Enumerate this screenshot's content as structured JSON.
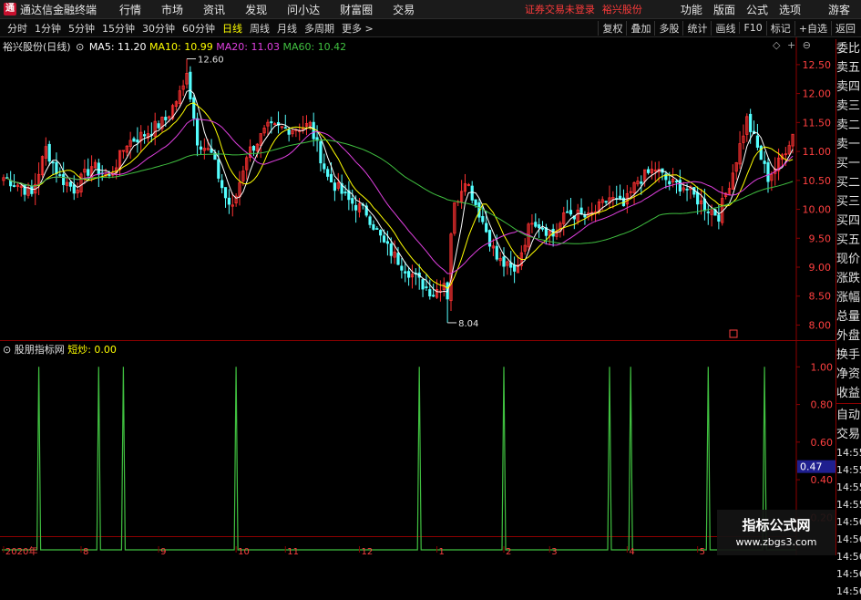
{
  "titlebar": {
    "app_name": "通达信金融终端",
    "menus": [
      "行情",
      "市场",
      "资讯",
      "发现",
      "问小达",
      "财富圈",
      "交易"
    ],
    "status": "证券交易未登录",
    "stock_name": "裕兴股份",
    "right_items": [
      "功能",
      "版面",
      "公式",
      "选项"
    ],
    "user": "游客"
  },
  "toolbar": {
    "periods": [
      "分时",
      "1分钟",
      "5分钟",
      "15分钟",
      "30分钟",
      "60分钟",
      "日线",
      "周线",
      "月线",
      "多周期",
      "更多 >"
    ],
    "active_period": "日线",
    "right_buttons": [
      "复权",
      "叠加",
      "多股",
      "统计",
      "画线",
      "F10",
      "标记",
      "+自选",
      "返回"
    ]
  },
  "main_legend": {
    "title": "裕兴股份(日线)",
    "ma": [
      {
        "label": "MA5: 11.20",
        "color": "#ffffff"
      },
      {
        "label": "MA10: 10.99",
        "color": "#ffff00"
      },
      {
        "label": "MA20: 11.03",
        "color": "#e040e0"
      },
      {
        "label": "MA60: 10.42",
        "color": "#40c040"
      }
    ]
  },
  "indicator_legend": {
    "name": "股朋指标网",
    "value_label": "短炒: 0.00",
    "value_color": "#ffff00"
  },
  "side_panel": {
    "items": [
      "委比",
      "卖五",
      "卖四",
      "卖三",
      "卖二",
      "卖一",
      "买一",
      "买二",
      "买三",
      "买四",
      "买五",
      "现价",
      "涨跌",
      "涨幅",
      "总量",
      "外盘",
      "换手",
      "净资",
      "收益",
      "自动",
      "交易"
    ],
    "times": [
      "14:55",
      "14:55",
      "14:55",
      "14:55",
      "14:56",
      "14:56",
      "14:56",
      "14:56",
      "14:56"
    ]
  },
  "watermark": {
    "line1": "指标公式网",
    "line2": "www.zbgs3.com"
  },
  "chart_data": [
    {
      "type": "candlestick",
      "title": "裕兴股份(日线)",
      "ylim": [
        7.85,
        12.75
      ],
      "yticks": [
        8.0,
        8.5,
        9.0,
        9.5,
        10.0,
        10.5,
        11.0,
        11.5,
        12.0,
        12.5
      ],
      "x_month_labels": [
        {
          "label": "2020年",
          "index": 0
        },
        {
          "label": "8",
          "index": 22
        },
        {
          "label": "9",
          "index": 44
        },
        {
          "label": "10",
          "index": 66
        },
        {
          "label": "11",
          "index": 80
        },
        {
          "label": "12",
          "index": 101
        },
        {
          "label": "1",
          "index": 123
        },
        {
          "label": "2",
          "index": 142
        },
        {
          "label": "3",
          "index": 155
        },
        {
          "label": "4",
          "index": 177
        },
        {
          "label": "5",
          "index": 197
        }
      ],
      "n_bars": 225,
      "annotations": [
        {
          "text": "12.60",
          "value": 12.6,
          "index": 52
        },
        {
          "text": "8.04",
          "value": 8.04,
          "index": 126
        }
      ],
      "close_anchors": [
        [
          0,
          10.55
        ],
        [
          5,
          10.4
        ],
        [
          8,
          10.25
        ],
        [
          12,
          11.05
        ],
        [
          16,
          10.55
        ],
        [
          20,
          10.35
        ],
        [
          25,
          10.75
        ],
        [
          30,
          10.55
        ],
        [
          35,
          11.15
        ],
        [
          40,
          11.3
        ],
        [
          46,
          11.55
        ],
        [
          51,
          12.1
        ],
        [
          52,
          12.35
        ],
        [
          55,
          11.2
        ],
        [
          59,
          10.95
        ],
        [
          63,
          10.2
        ],
        [
          65,
          10.0
        ],
        [
          69,
          10.95
        ],
        [
          75,
          11.4
        ],
        [
          82,
          11.4
        ],
        [
          87,
          11.45
        ],
        [
          92,
          10.55
        ],
        [
          98,
          10.15
        ],
        [
          103,
          9.95
        ],
        [
          108,
          9.4
        ],
        [
          113,
          9.05
        ],
        [
          118,
          8.75
        ],
        [
          122,
          8.55
        ],
        [
          125,
          8.75
        ],
        [
          128,
          10.05
        ],
        [
          131,
          10.55
        ],
        [
          135,
          9.95
        ],
        [
          140,
          9.15
        ],
        [
          145,
          8.9
        ],
        [
          150,
          9.85
        ],
        [
          156,
          9.55
        ],
        [
          160,
          9.95
        ],
        [
          166,
          9.85
        ],
        [
          172,
          10.2
        ],
        [
          176,
          10.05
        ],
        [
          180,
          10.5
        ],
        [
          185,
          10.7
        ],
        [
          189,
          10.45
        ],
        [
          193,
          10.4
        ],
        [
          199,
          10.05
        ],
        [
          203,
          9.9
        ],
        [
          207,
          10.65
        ],
        [
          211,
          11.55
        ],
        [
          214,
          11.05
        ],
        [
          217,
          10.55
        ],
        [
          220,
          10.8
        ],
        [
          224,
          11.3
        ]
      ],
      "ma_last": {
        "MA5": 11.2,
        "MA10": 10.99,
        "MA20": 11.03,
        "MA60": 10.42
      },
      "up_color": "#ff3232",
      "down_color": "#54ffff"
    },
    {
      "type": "line",
      "title": "股朋指标网",
      "series": [
        {
          "name": "短炒",
          "color": "#40c040"
        }
      ],
      "ylim": [
        0.1,
        1.05
      ],
      "yticks": [
        0.2,
        0.4,
        0.6,
        0.8,
        1.0
      ],
      "current_value_box": "0.47",
      "spike_indices": [
        10,
        27,
        34,
        66,
        118,
        142,
        172,
        178,
        200,
        216
      ],
      "spike_value": 1.0,
      "base_value": 0.0
    }
  ]
}
